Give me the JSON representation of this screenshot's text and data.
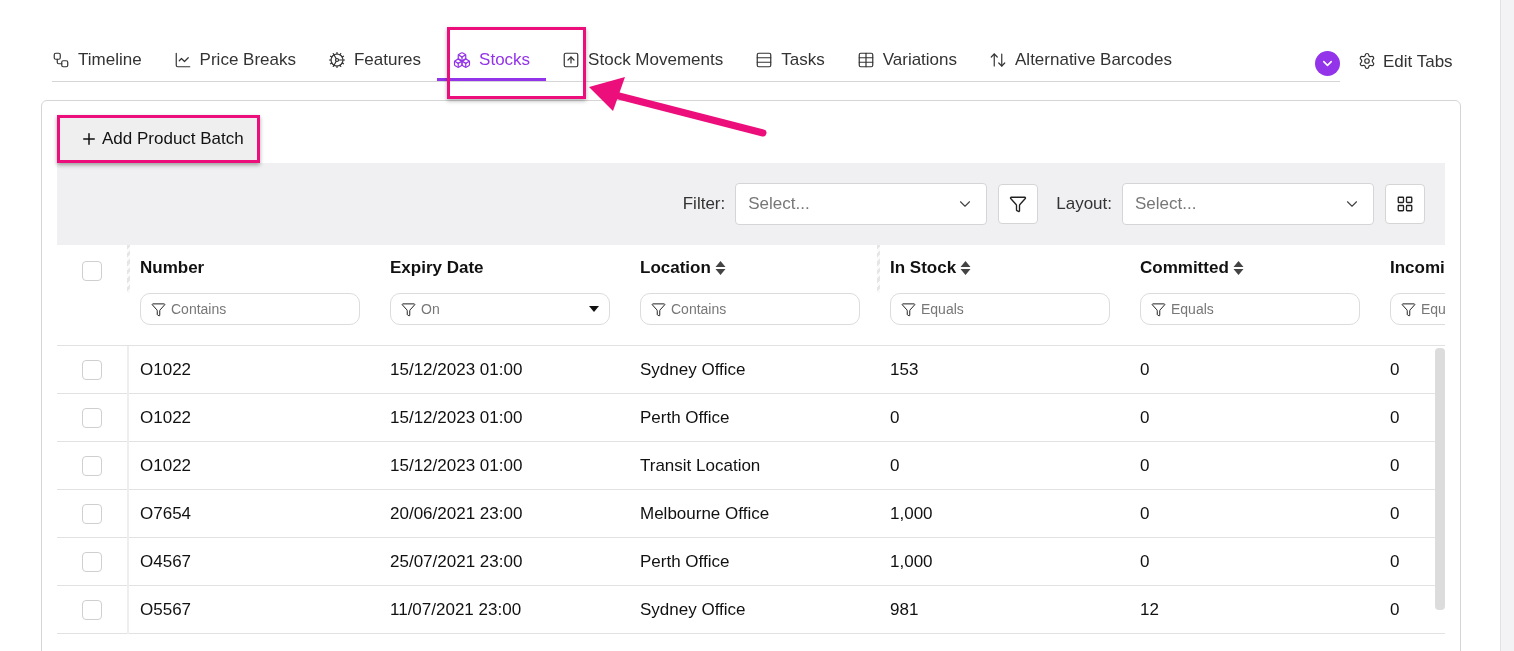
{
  "tabs": [
    {
      "label": "Timeline",
      "selected": false
    },
    {
      "label": "Price Breaks",
      "selected": false
    },
    {
      "label": "Features",
      "selected": false
    },
    {
      "label": "Stocks",
      "selected": true
    },
    {
      "label": "Stock Movements",
      "selected": false
    },
    {
      "label": "Tasks",
      "selected": false
    },
    {
      "label": "Variations",
      "selected": false
    },
    {
      "label": "Alternative Barcodes",
      "selected": false
    }
  ],
  "edit_tabs": {
    "label": "Edit Tabs"
  },
  "add_button": {
    "label": "Add Product Batch"
  },
  "toolbar": {
    "filter": {
      "label": "Filter:",
      "placeholder": "Select..."
    },
    "layout": {
      "label": "Layout:",
      "placeholder": "Select..."
    }
  },
  "table": {
    "select_all": {
      "checked": false
    },
    "columns": [
      {
        "label": "Number",
        "sortable": false,
        "kind": "text",
        "filter_placeholder": "Contains"
      },
      {
        "label": "Expiry Date",
        "sortable": false,
        "kind": "dropdown",
        "filter_placeholder": "On"
      },
      {
        "label": "Location",
        "sortable": true,
        "kind": "text",
        "filter_placeholder": "Contains"
      },
      {
        "label": "In Stock",
        "sortable": true,
        "kind": "text",
        "filter_placeholder": "Equals"
      },
      {
        "label": "Committed",
        "sortable": true,
        "kind": "text",
        "filter_placeholder": "Equals"
      },
      {
        "label": "Incomi",
        "kind": "text",
        "filter_placeholder": "Equ"
      }
    ],
    "rows": [
      {
        "selected": false,
        "cells": [
          "O1022",
          "15/12/2023 01:00",
          "Sydney Office",
          "153",
          "0",
          "0"
        ]
      },
      {
        "selected": false,
        "cells": [
          "O1022",
          "15/12/2023 01:00",
          "Perth Office",
          "0",
          "0",
          "0"
        ]
      },
      {
        "selected": false,
        "cells": [
          "O1022",
          "15/12/2023 01:00",
          "Transit Location",
          "0",
          "0",
          "0"
        ]
      },
      {
        "selected": false,
        "cells": [
          "O7654",
          "20/06/2021 23:00",
          "Melbourne Office",
          "1,000",
          "0",
          "0"
        ]
      },
      {
        "selected": false,
        "cells": [
          "O4567",
          "25/07/2021 23:00",
          "Perth Office",
          "1,000",
          "0",
          "0"
        ]
      },
      {
        "selected": false,
        "cells": [
          "O5567",
          "11/07/2021 23:00",
          "Sydney Office",
          "981",
          "12",
          "0"
        ]
      }
    ]
  }
}
